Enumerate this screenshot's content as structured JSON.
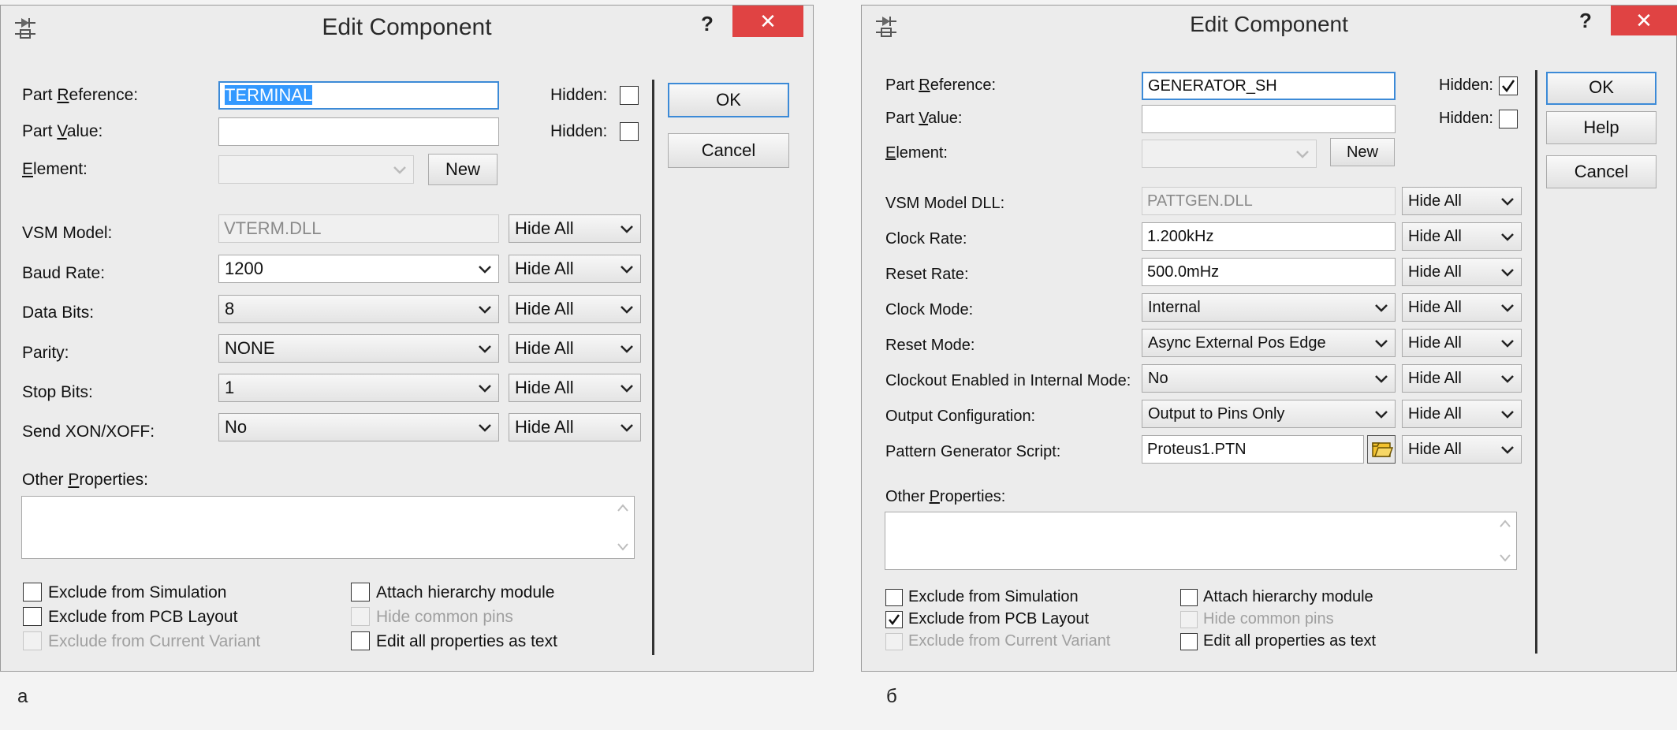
{
  "dialogs": [
    {
      "title": "Edit Component",
      "help": "?",
      "close": "✕",
      "part_reference": {
        "label_pre": "Part ",
        "label_u": "R",
        "label_post": "eference:",
        "value": "TERMINAL"
      },
      "part_value": {
        "label_pre": "Part ",
        "label_u": "V",
        "label_post": "alue:",
        "value": ""
      },
      "element": {
        "label_u": "E",
        "label_post": "lement:",
        "new_label": "New"
      },
      "hidden_label": "Hidden:",
      "props": [
        {
          "label": "VSM Model:",
          "value": "VTERM.DLL",
          "hide": "Hide All"
        },
        {
          "label": "Baud Rate:",
          "value": "1200",
          "hide": "Hide All"
        },
        {
          "label": "Data Bits:",
          "value": "8",
          "hide": "Hide All"
        },
        {
          "label": "Parity:",
          "value": "NONE",
          "hide": "Hide All"
        },
        {
          "label": "Stop Bits:",
          "value": "1",
          "hide": "Hide All"
        },
        {
          "label": "Send XON/XOFF:",
          "value": "No",
          "hide": "Hide All"
        }
      ],
      "other_props": {
        "label_pre": "Other ",
        "label_u": "P",
        "label_post": "roperties:"
      },
      "checks": {
        "excl_sim": "Exclude from Simulation",
        "excl_pcb": "Exclude from PCB Layout",
        "excl_variant": "Exclude from Current Variant",
        "attach": "Attach hierarchy module",
        "hide_pins": "Hide common pins",
        "edit_text": "Edit all properties as text"
      },
      "buttons": {
        "ok": "OK",
        "cancel": "Cancel"
      },
      "caption": "а"
    },
    {
      "title": "Edit Component",
      "help": "?",
      "close": "✕",
      "part_reference": {
        "label_pre": "Part ",
        "label_u": "R",
        "label_post": "eference:",
        "value": "GENERATOR_SH"
      },
      "part_value": {
        "label_pre": "Part ",
        "label_u": "V",
        "label_post": "alue:",
        "value": ""
      },
      "element": {
        "label_u": "E",
        "label_post": "lement:",
        "new_label": "New"
      },
      "hidden_label": "Hidden:",
      "props": [
        {
          "label": "VSM Model DLL:",
          "value": "PATTGEN.DLL",
          "hide": "Hide All"
        },
        {
          "label": "Clock Rate:",
          "value": "1.200kHz",
          "hide": "Hide All"
        },
        {
          "label": "Reset Rate:",
          "value": "500.0mHz",
          "hide": "Hide All"
        },
        {
          "label": "Clock Mode:",
          "value": "Internal",
          "hide": "Hide All"
        },
        {
          "label": "Reset Mode:",
          "value": "Async External Pos Edge",
          "hide": "Hide All"
        },
        {
          "label": "Clockout Enabled in Internal Mode:",
          "value": "No",
          "hide": "Hide All"
        },
        {
          "label": "Output Configuration:",
          "value": "Output to Pins Only",
          "hide": "Hide All"
        },
        {
          "label": "Pattern Generator Script:",
          "value": "Proteus1.PTN",
          "hide": "Hide All"
        }
      ],
      "other_props": {
        "label_pre": "Other ",
        "label_u": "P",
        "label_post": "roperties:"
      },
      "checks": {
        "excl_sim": "Exclude from Simulation",
        "excl_pcb": "Exclude from PCB Layout",
        "excl_variant": "Exclude from Current Variant",
        "attach": "Attach hierarchy module",
        "hide_pins": "Hide common pins",
        "edit_text": "Edit all properties as text"
      },
      "buttons": {
        "ok": "OK",
        "help": "Help",
        "cancel": "Cancel"
      },
      "caption": "б"
    }
  ],
  "icons": {
    "app": "component-icon",
    "caret": "chevron-down-icon",
    "check": "checkmark-icon",
    "folder": "folder-icon",
    "scroll_up": "scroll-up-icon",
    "scroll_down": "scroll-down-icon"
  },
  "colors": {
    "close": "#e04343",
    "focus": "#3c8ad7",
    "selection": "#3399ff",
    "folder": "#f2c12e"
  }
}
